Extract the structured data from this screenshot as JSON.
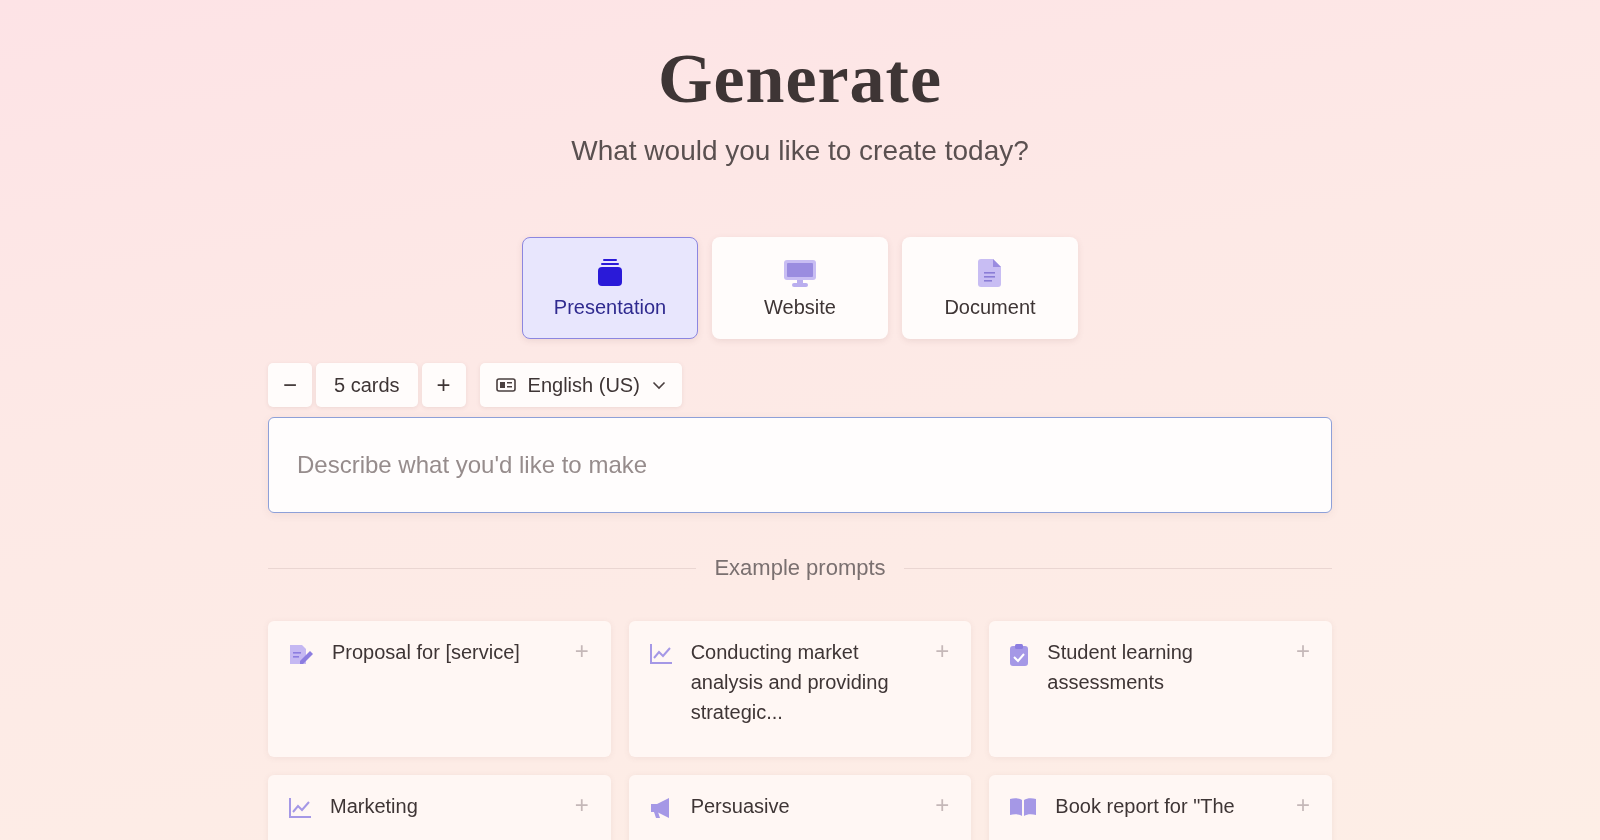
{
  "title": "Generate",
  "subtitle": "What would you like to create today?",
  "tabs": [
    {
      "label": "Presentation",
      "kind": "presentation",
      "selected": true
    },
    {
      "label": "Website",
      "kind": "website",
      "selected": false
    },
    {
      "label": "Document",
      "kind": "document",
      "selected": false
    }
  ],
  "card_count": {
    "decrement": "−",
    "value": "5 cards",
    "increment": "+"
  },
  "language": {
    "label": "English (US)"
  },
  "prompt_field": {
    "placeholder": "Describe what you'd like to make"
  },
  "examples_heading": "Example prompts",
  "examples": [
    {
      "kind": "proposal",
      "text": "Proposal for [service]",
      "add": "+"
    },
    {
      "kind": "chart",
      "text": "Conducting market analysis and providing strategic...",
      "add": "+"
    },
    {
      "kind": "clipboard",
      "text": "Student learning assessments",
      "add": "+"
    },
    {
      "kind": "chart",
      "text": "Marketing",
      "add": "+"
    },
    {
      "kind": "megaphone",
      "text": "Persuasive",
      "add": "+"
    },
    {
      "kind": "book",
      "text": "Book report for \"The",
      "add": "+"
    }
  ]
}
